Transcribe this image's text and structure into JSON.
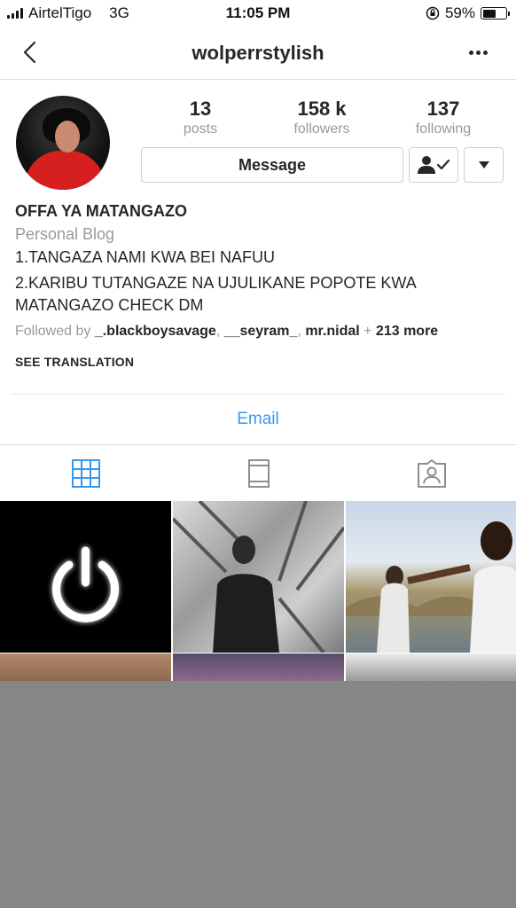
{
  "status_bar": {
    "carrier": "AirtelTigo",
    "network": "3G",
    "time": "11:05 PM",
    "battery_percent": "59%",
    "battery_level": 0.59
  },
  "nav": {
    "title": "wolperrstylish"
  },
  "profile": {
    "stats": [
      {
        "value": "13",
        "label": "posts"
      },
      {
        "value": "158 k",
        "label": "followers"
      },
      {
        "value": "137",
        "label": "following"
      }
    ],
    "message_button": "Message"
  },
  "bio": {
    "name": "OFFA YA MATANGAZO",
    "category": "Personal Blog",
    "lines": [
      "1.TANGAZA NAMI KWA BEI NAFUU",
      "2.KARIBU TUTANGAZE NA UJULIKANE POPOTE KWA",
      "MATANGAZO CHECK DM"
    ],
    "followed_by_prefix": "Followed by",
    "followed_by_users": [
      "_.blackboysavage",
      "__seyram_",
      "mr.nidal"
    ],
    "followed_by_more": "213 more",
    "see_translation": "SEE TRANSLATION"
  },
  "contact": {
    "email_label": "Email"
  },
  "tabs": [
    {
      "icon": "grid-icon",
      "active": true
    },
    {
      "icon": "feed-icon",
      "active": false
    },
    {
      "icon": "tagged-icon",
      "active": false
    }
  ],
  "colors": {
    "link": "#3897f0",
    "muted": "#999999",
    "text": "#262626",
    "overlay": "#868686"
  }
}
